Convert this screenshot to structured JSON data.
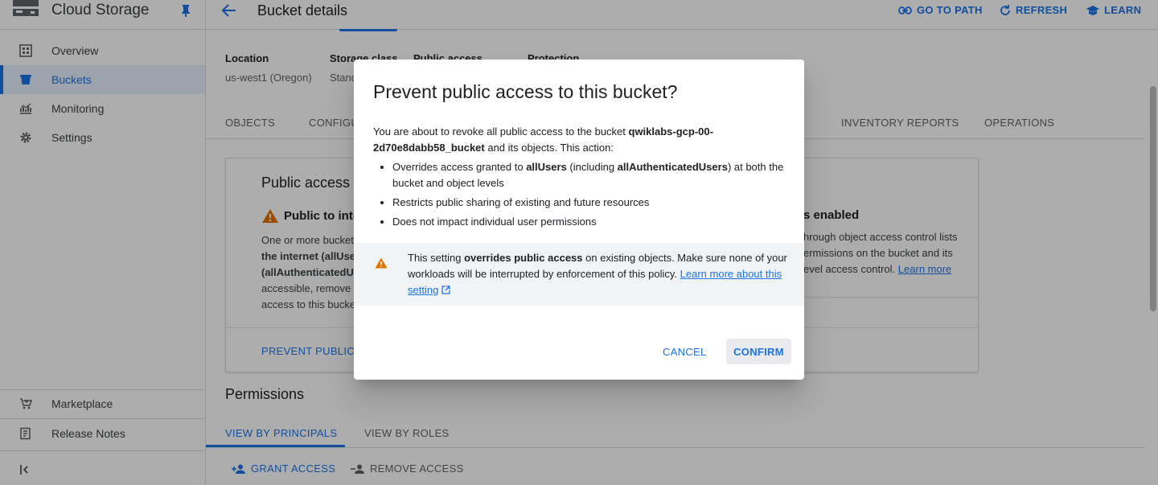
{
  "sidebar": {
    "title": "Cloud Storage",
    "items": [
      {
        "label": "Overview",
        "icon": "dashboard-icon"
      },
      {
        "label": "Buckets",
        "icon": "bucket-icon"
      },
      {
        "label": "Monitoring",
        "icon": "monitoring-icon"
      },
      {
        "label": "Settings",
        "icon": "gear-icon"
      }
    ],
    "bottom_items": [
      {
        "label": "Marketplace",
        "icon": "cart-icon"
      },
      {
        "label": "Release Notes",
        "icon": "notes-icon"
      }
    ],
    "active_index": 1
  },
  "header": {
    "title": "Bucket details",
    "actions": {
      "go_to_path": "GO TO PATH",
      "refresh": "REFRESH",
      "learn": "LEARN"
    }
  },
  "bucket_info": {
    "location_label": "Location",
    "location_value": "us-west1 (Oregon)",
    "storage_class_label": "Storage class",
    "storage_class_value": "Stand",
    "public_access_label": "Public access",
    "protection_label": "Protection"
  },
  "tabs": [
    "OBJECTS",
    "CONFIGU",
    "INVENTORY REPORTS",
    "OPERATIONS"
  ],
  "public_access_card": {
    "title": "Public access",
    "warning_heading": "Public to inte",
    "text_lines": [
      "One or more bucket-",
      "the internet (allUsers",
      "(allAuthenticatedUs",
      "accessible, remove t",
      "access to this bucke"
    ],
    "right_heading": "s enabled",
    "right_text_1": "hrough object access control lists",
    "right_text_2": "ermissions on the bucket and its",
    "right_text_3": "evel access control.",
    "right_link": "Learn more",
    "prevent_button": "PREVENT PUBLIC A"
  },
  "permissions": {
    "title": "Permissions",
    "tabs": [
      "VIEW BY PRINCIPALS",
      "VIEW BY ROLES"
    ],
    "grant_access": "GRANT ACCESS",
    "remove_access": "REMOVE ACCESS"
  },
  "dialog": {
    "title": "Prevent public access to this bucket?",
    "intro_prefix": "You are about to revoke all public access to the bucket ",
    "bucket_name": "qwiklabs-gcp-00-2d70e8dabb58_bucket",
    "intro_suffix": " and its objects. This action:",
    "bullet1_prefix": "Overrides access granted to ",
    "bullet1_b1": "allUsers",
    "bullet1_mid": " (including ",
    "bullet1_b2": "allAuthenticatedUsers",
    "bullet1_suffix": ") at both the bucket and object levels",
    "bullet2": "Restricts public sharing of existing and future resources",
    "bullet3": "Does not impact individual user permissions",
    "warning_prefix": "This setting ",
    "warning_bold": "overrides public access",
    "warning_suffix": " on existing objects. Make sure none of your workloads will be interrupted by enforcement of this policy. ",
    "warning_link": "Learn more about this setting",
    "cancel": "CANCEL",
    "confirm": "CONFIRM"
  },
  "colors": {
    "accent": "#1a73e8",
    "warning": "#e37400",
    "overlay": "rgba(0,0,0,0.32)"
  }
}
